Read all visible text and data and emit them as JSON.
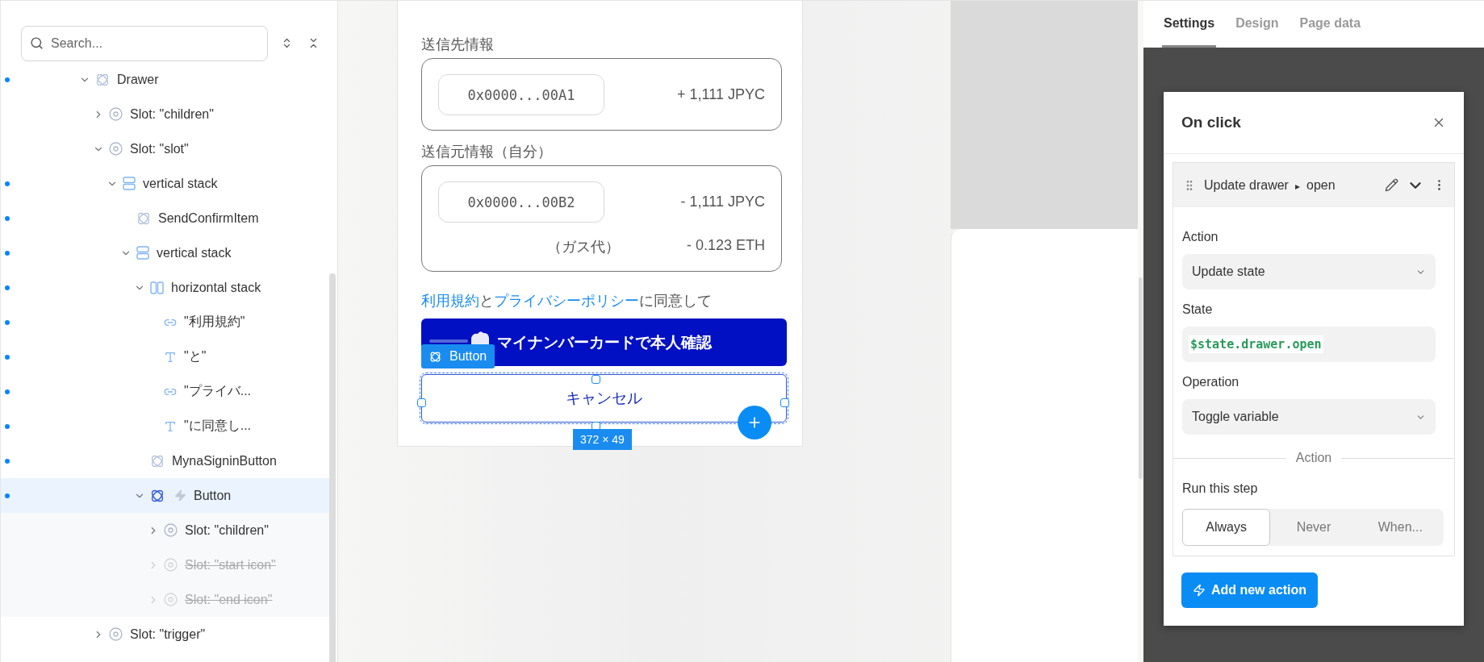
{
  "tree": {
    "search": {
      "placeholder": "Search..."
    },
    "items": [
      {
        "label": "Drawer",
        "kind": "component",
        "indicator": true,
        "expanded": true,
        "children": [
          {
            "label": "Slot: \"children\"",
            "kind": "slot",
            "indicator": false,
            "expanded": false
          },
          {
            "label": "Slot: \"slot\"",
            "kind": "slot",
            "indicator": false,
            "expanded": true,
            "children": [
              {
                "label": "vertical stack",
                "kind": "vstack",
                "indicator": true,
                "expanded": true,
                "children": [
                  {
                    "label": "SendConfirmItem",
                    "kind": "component",
                    "indicator": true
                  },
                  {
                    "label": "vertical stack",
                    "kind": "vstack",
                    "indicator": true,
                    "expanded": true,
                    "children": [
                      {
                        "label": "horizontal stack",
                        "kind": "hstack",
                        "indicator": true,
                        "expanded": true,
                        "children": [
                          {
                            "label": "\"利用規約\"",
                            "kind": "link",
                            "indicator": true
                          },
                          {
                            "label": "\"と\"",
                            "kind": "text",
                            "indicator": true
                          },
                          {
                            "label": "\"プライバ...",
                            "kind": "link",
                            "indicator": true
                          },
                          {
                            "label": "\"に同意し...",
                            "kind": "text",
                            "indicator": true
                          }
                        ]
                      },
                      {
                        "label": "MynaSigninButton",
                        "kind": "component",
                        "indicator": true
                      },
                      {
                        "label": "Button",
                        "kind": "component",
                        "indicator": true,
                        "selected": true,
                        "interaction": true,
                        "expanded": true,
                        "children": [
                          {
                            "label": "Slot: \"children\"",
                            "kind": "slot",
                            "indicator": false,
                            "expanded": false,
                            "disabled": false
                          },
                          {
                            "label": "Slot: \"start icon\"",
                            "kind": "slot",
                            "indicator": false,
                            "expanded": false,
                            "disabled": true
                          },
                          {
                            "label": "Slot: \"end icon\"",
                            "kind": "slot",
                            "indicator": false,
                            "expanded": false,
                            "disabled": true
                          }
                        ]
                      }
                    ]
                  }
                ]
              }
            ]
          },
          {
            "label": "Slot: \"trigger\"",
            "kind": "slot",
            "indicator": false,
            "expanded": false
          }
        ]
      }
    ]
  },
  "canvas": {
    "sections": [
      {
        "label": "送信先情報",
        "address": "0x0000...00A1",
        "amount": "+ 1,111 JPYC"
      },
      {
        "label": "送信元情報（自分）",
        "address": "0x0000...00B2",
        "amount": "- 1,111 JPYC",
        "gas_label": "（ガス代）",
        "gas_amount": "- 0.123 ETH"
      }
    ],
    "terms": [
      {
        "text": "利用規約",
        "kind": "link"
      },
      {
        "text": "と",
        "kind": "text"
      },
      {
        "text": "プライバシーポリシー",
        "kind": "link"
      },
      {
        "text": "に同意して",
        "kind": "text"
      }
    ],
    "primary_button": "マイナンバーカードで本人確認",
    "cancel_button": "キャンセル",
    "selection": {
      "label": "Button",
      "size": "372 × 49"
    }
  },
  "panel": {
    "tabs": [
      {
        "label": "Settings",
        "selected": true
      },
      {
        "label": "Design",
        "selected": false
      },
      {
        "label": "Page data",
        "selected": false
      }
    ],
    "dialog": {
      "title": "On click",
      "step": {
        "title": "Update drawer",
        "separator": "▸",
        "target": "open",
        "expanded": true
      },
      "fields": [
        {
          "label": "Action",
          "kind": "select",
          "value": "Update state"
        },
        {
          "label": "State",
          "kind": "code",
          "value": "$state.drawer.open"
        },
        {
          "label": "Operation",
          "kind": "select",
          "value": "Toggle variable"
        }
      ],
      "divider": "Action",
      "run": {
        "label": "Run this step",
        "options": [
          {
            "label": "Always",
            "selected": true
          },
          {
            "label": "Never",
            "selected": false
          },
          {
            "label": "When...",
            "selected": false
          }
        ]
      },
      "add_button": "Add new action"
    }
  }
}
